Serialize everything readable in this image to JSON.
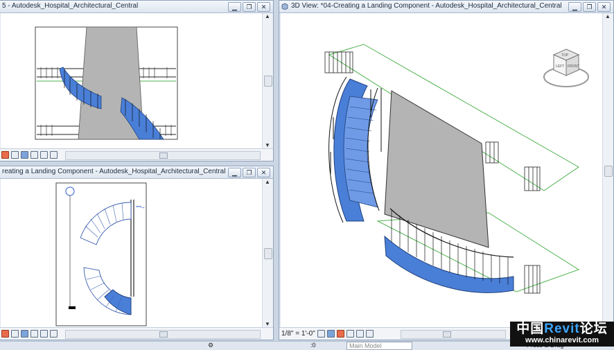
{
  "windows": {
    "top_left": {
      "title": "5 - Autodesk_Hospital_Architectural_Central"
    },
    "bottom_left": {
      "title": "reating a Landing Component - Autodesk_Hospital_Architectural_Central"
    },
    "right": {
      "title": "3D View: *04-Creating a Landing Component - Autodesk_Hospital_Architectural_Central",
      "scale": "1/8\" = 1'-0\""
    }
  },
  "viewcube": {
    "front": "FRONT",
    "left": "LEFT",
    "top": "TOP"
  },
  "statusbar": {
    "pane_label": ":0",
    "model": "Main Model",
    "press_drag": "Press & Drag"
  },
  "watermark": {
    "cn1": "中国",
    "brand": "Revit",
    "cn2": "论坛",
    "url": "www.chinarevit.com"
  },
  "colors": {
    "stair_blue": "#4a7fd8",
    "wall_gray": "#b4b4b4",
    "outline_green": "#4fb24f",
    "accent": "#3aa6ff"
  }
}
